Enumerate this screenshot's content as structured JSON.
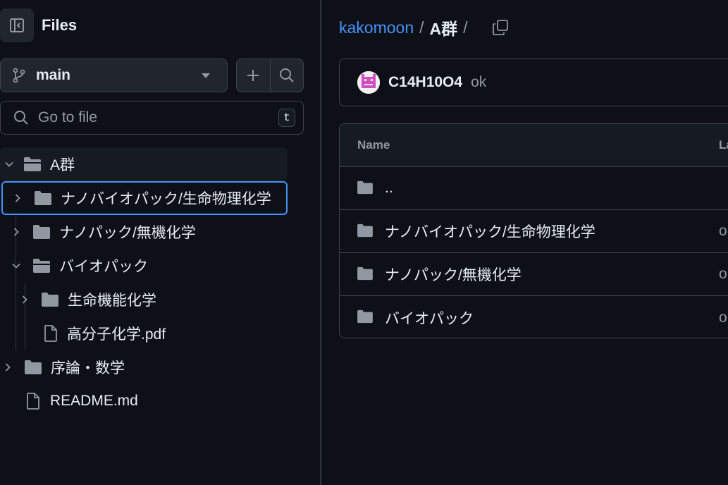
{
  "sidebar": {
    "title": "Files",
    "branch": "main",
    "goto_placeholder": "Go to file",
    "goto_shortcut": "t",
    "tree": [
      {
        "label": "A群",
        "type": "folder-open"
      },
      {
        "label": "ナノバイオパック/生命物理化学",
        "type": "folder"
      },
      {
        "label": "ナノパック/無機化学",
        "type": "folder"
      },
      {
        "label": "バイオパック",
        "type": "folder-open"
      },
      {
        "label": "生命機能化学",
        "type": "folder"
      },
      {
        "label": "高分子化学.pdf",
        "type": "file"
      },
      {
        "label": "序論・数学",
        "type": "folder"
      },
      {
        "label": "README.md",
        "type": "file"
      }
    ]
  },
  "main": {
    "breadcrumb": {
      "repo": "kakomoon",
      "sep": "/",
      "current": "A群",
      "trailing_sep": "/"
    },
    "commit": {
      "author": "C14H10O4",
      "message": "ok"
    },
    "table": {
      "headers": {
        "name": "Name",
        "last_commit": "La"
      },
      "rows": [
        {
          "name": "..",
          "message": ""
        },
        {
          "name": "ナノバイオパック/生命物理化学",
          "message": "ok"
        },
        {
          "name": "ナノパック/無機化学",
          "message": "ok"
        },
        {
          "name": "バイオパック",
          "message": "ok"
        }
      ]
    }
  },
  "colors": {
    "accent": "#4493f8",
    "bg": "#0d1117",
    "border": "#3d444d",
    "muted": "#9198a1",
    "icon": "#9198a1"
  }
}
